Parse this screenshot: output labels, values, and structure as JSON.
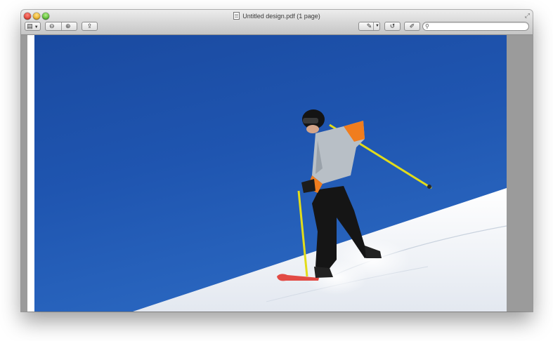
{
  "window": {
    "title": "Untitled design.pdf (1 page)"
  },
  "toolbar": {
    "sidebar_icon": "sidebar-view-icon",
    "dropdown_icon": "chevron-down-icon",
    "zoom_out_icon": "zoom-out-icon",
    "zoom_in_icon": "zoom-in-icon",
    "share_icon": "share-icon",
    "annotate_icon": "pen-markup-icon",
    "rotate_icon": "rotate-icon",
    "edit_icon": "edit-icon",
    "search_icon": "search-icon",
    "search_value": ""
  },
  "document": {
    "page_image": "Skier descending a snowy slope under a deep blue sky"
  },
  "colors": {
    "sky": "#1d4fa6",
    "snow": "#f4f6fa",
    "jacket": "#f07d1e",
    "poles": "#e8e01a"
  }
}
